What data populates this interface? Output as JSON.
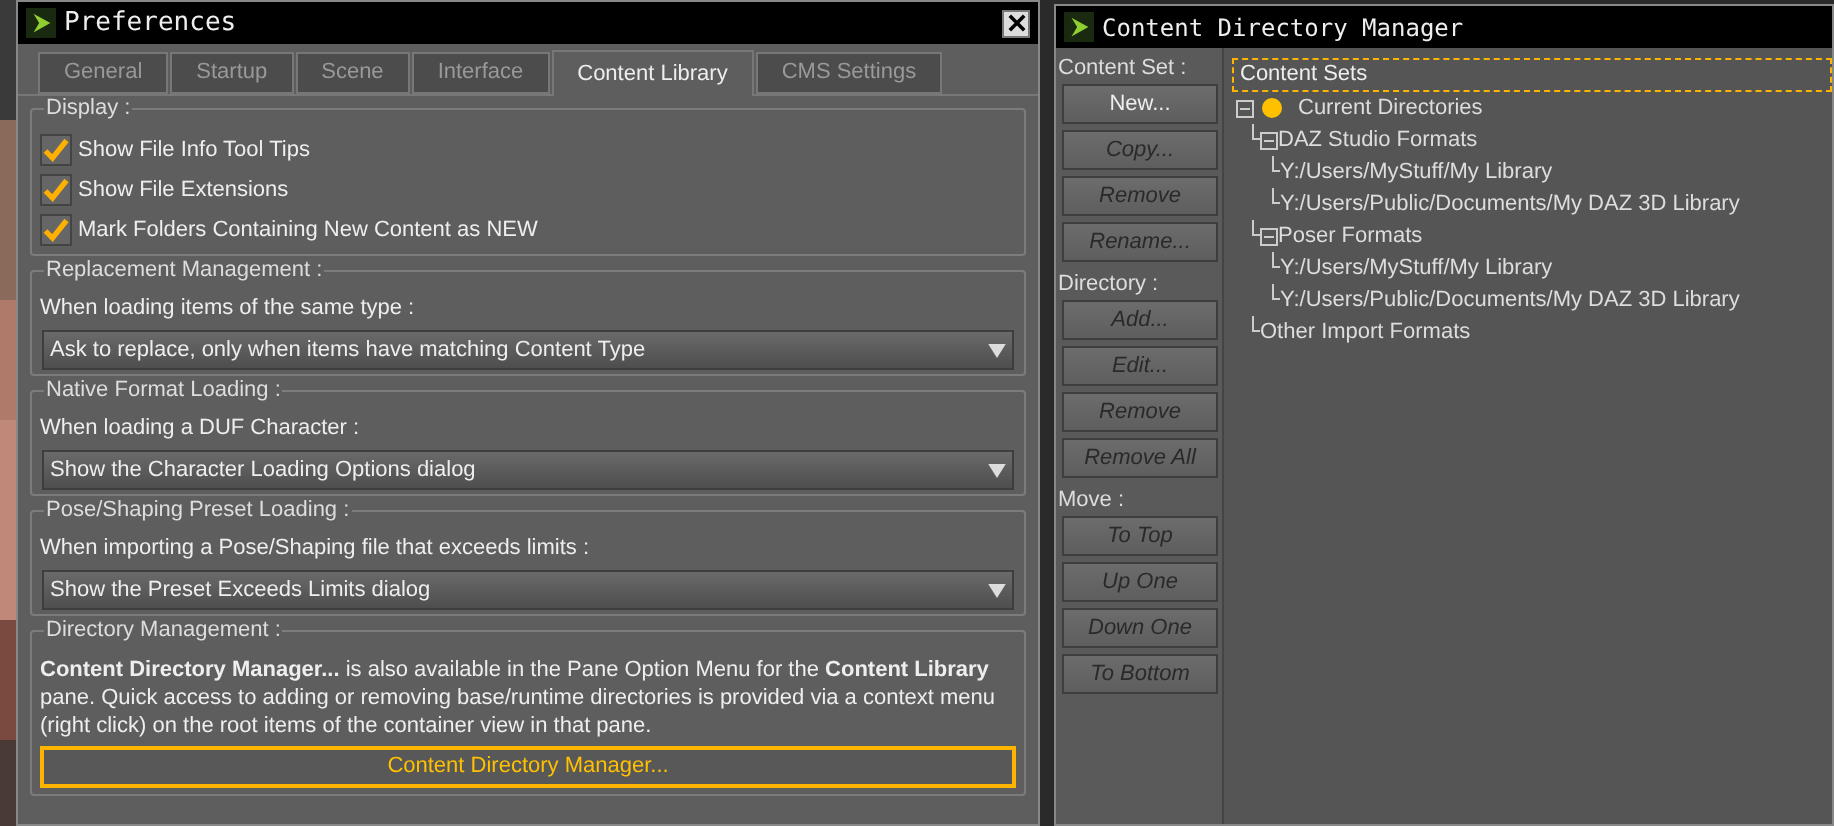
{
  "preferences": {
    "title": "Preferences",
    "tabs": [
      {
        "label": "General",
        "selected": false
      },
      {
        "label": "Startup",
        "selected": false
      },
      {
        "label": "Scene",
        "selected": false
      },
      {
        "label": "Interface",
        "selected": false
      },
      {
        "label": "Content Library",
        "selected": true
      },
      {
        "label": "CMS Settings",
        "selected": false
      }
    ],
    "groups": [
      {
        "kind": "checks",
        "title": "Display :",
        "items": [
          {
            "label": "Show File Info Tool Tips",
            "checked": true
          },
          {
            "label": "Show File Extensions",
            "checked": true
          },
          {
            "label": "Mark Folders Containing New Content as NEW",
            "checked": true
          }
        ]
      },
      {
        "kind": "select",
        "title": "Replacement Management :",
        "prompt": "When loading items of the same type :",
        "value": "Ask to replace, only when items have matching Content Type"
      },
      {
        "kind": "select",
        "title": "Native Format Loading :",
        "prompt": "When loading a DUF Character :",
        "value": "Show the Character Loading Options dialog"
      },
      {
        "kind": "select",
        "title": "Pose/Shaping Preset Loading :",
        "prompt": "When importing a Pose/Shaping file that exceeds limits :",
        "value": "Show the Preset Exceeds Limits dialog"
      },
      {
        "kind": "info",
        "title": "Directory Management :",
        "text": "**Content Directory Manager...** is also available in the Pane Option Menu for the **Content Library** pane. Quick access to adding or removing base/runtime directories is provided via a context menu (right click) on the root items of the container view in that pane.",
        "button": "Content Directory Manager..."
      }
    ]
  },
  "manager": {
    "title": "Content Directory Manager",
    "sections": [
      {
        "label": "Content Set :",
        "buttons": [
          {
            "label": "New...",
            "disabled": false
          },
          {
            "label": "Copy...",
            "disabled": true
          },
          {
            "label": "Remove",
            "disabled": true
          },
          {
            "label": "Rename...",
            "disabled": true
          }
        ]
      },
      {
        "label": "Directory :",
        "buttons": [
          {
            "label": "Add...",
            "disabled": true
          },
          {
            "label": "Edit...",
            "disabled": true
          },
          {
            "label": "Remove",
            "disabled": true
          },
          {
            "label": "Remove All",
            "disabled": true
          }
        ]
      },
      {
        "label": "Move :",
        "buttons": [
          {
            "label": "To Top",
            "disabled": true
          },
          {
            "label": "Up One",
            "disabled": true
          },
          {
            "label": "Down One",
            "disabled": true
          },
          {
            "label": "To Bottom",
            "disabled": true
          }
        ]
      }
    ],
    "tree": {
      "label": "Content Sets",
      "selected": true,
      "children": [
        {
          "label": "Current Directories",
          "expanded": true,
          "color": "#ffc000",
          "children": [
            {
              "label": "DAZ Studio Formats",
              "expanded": true,
              "children": [
                {
                  "label": "Y:/Users/MyStuff/My Library"
                },
                {
                  "label": "Y:/Users/Public/Documents/My DAZ 3D Library"
                }
              ]
            },
            {
              "label": "Poser Formats",
              "expanded": true,
              "children": [
                {
                  "label": "Y:/Users/MyStuff/My Library"
                },
                {
                  "label": "Y:/Users/Public/Documents/My DAZ 3D Library"
                }
              ]
            },
            {
              "label": "Other Import Formats"
            }
          ]
        }
      ]
    }
  }
}
